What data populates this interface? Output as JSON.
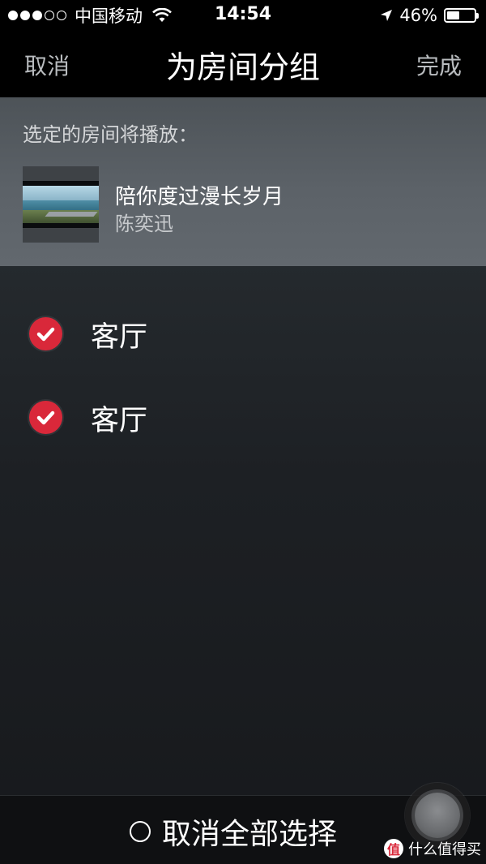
{
  "status_bar": {
    "carrier": "中国移动",
    "time": "14:54",
    "battery_percent": "46%",
    "battery_level": 0.46,
    "signal_dots_filled": 3,
    "signal_dots_total": 5,
    "icons": [
      "wifi-icon",
      "location-arrow-icon",
      "battery-icon"
    ]
  },
  "nav": {
    "cancel_label": "取消",
    "title": "为房间分组",
    "done_label": "完成"
  },
  "now_playing": {
    "caption": "选定的房间将播放：",
    "track_title": "陪你度过漫长岁月",
    "artist": "陈奕迅"
  },
  "rooms": [
    {
      "label": "客厅",
      "checked": true
    },
    {
      "label": "客厅",
      "checked": true
    }
  ],
  "bottom_bar": {
    "deselect_all_label": "取消全部选择"
  },
  "watermark": {
    "text": "什么值得买",
    "badge": "值"
  },
  "colors": {
    "accent_red": "#d9283a",
    "nav_background": "#000000",
    "panel_background": "#5c6268"
  }
}
